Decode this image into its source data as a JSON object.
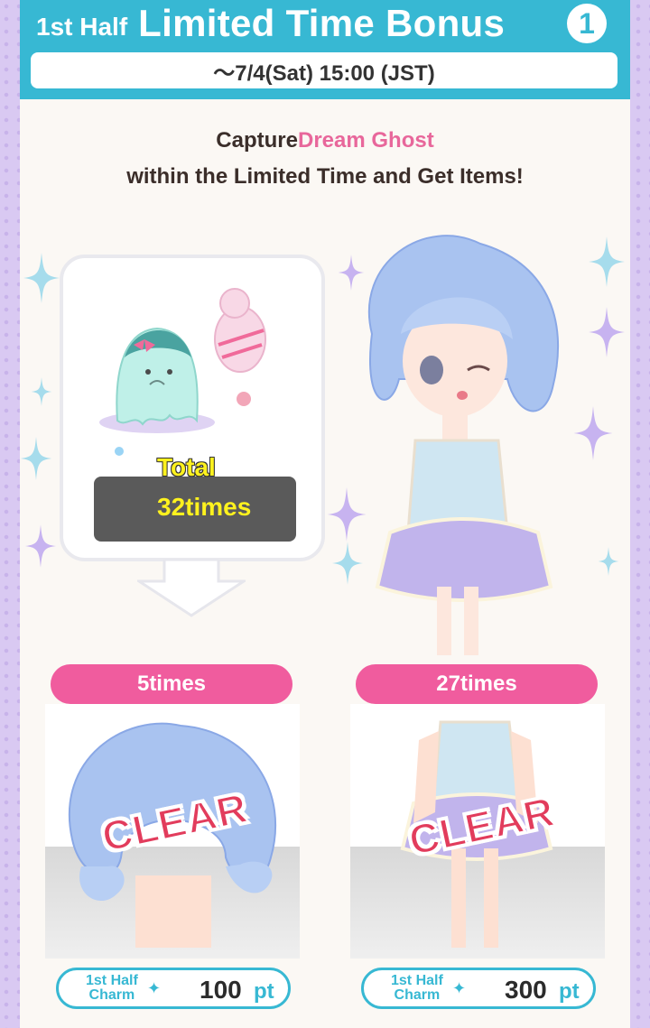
{
  "header": {
    "small_title": "1st Half",
    "big_title": "Limited Time Bonus",
    "number": "1",
    "date": "〜7/4(Sat) 15:00 (JST)"
  },
  "intro": {
    "prefix": "Capture",
    "target": "Dream Ghost",
    "line2": "within the Limited Time and Get Items!"
  },
  "progress": {
    "label": "Total",
    "value": "32times"
  },
  "rewards": [
    {
      "times": "5times",
      "stamp": "CLEAR",
      "charm": "1st Half Charm",
      "points": "100",
      "unit": "pt",
      "item": "hair"
    },
    {
      "times": "27times",
      "stamp": "CLEAR",
      "charm": "1st Half Charm",
      "points": "300",
      "unit": "pt",
      "item": "outfit"
    }
  ],
  "colors": {
    "header": "#37b8d3",
    "pink": "#e8679b",
    "tab": "#f05c9e",
    "stamp": "#e23c5c",
    "total_text": "#fff21e"
  }
}
